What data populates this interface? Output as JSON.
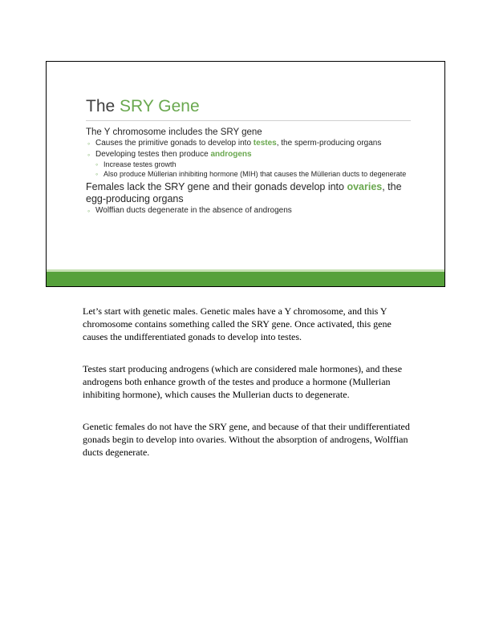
{
  "slide": {
    "title_prefix": "The ",
    "title_accent": "SRY Gene",
    "lines": [
      {
        "level": 1,
        "parts": [
          {
            "text": "The Y chromosome includes the SRY gene"
          }
        ]
      },
      {
        "level": 2,
        "parts": [
          {
            "text": "Causes the primitive gonads to develop into "
          },
          {
            "text": "testes",
            "hl": true
          },
          {
            "text": ", the sperm-producing organs"
          }
        ]
      },
      {
        "level": 2,
        "parts": [
          {
            "text": "Developing testes then produce "
          },
          {
            "text": "androgens",
            "hl": true
          }
        ]
      },
      {
        "level": 3,
        "parts": [
          {
            "text": "Increase testes growth"
          }
        ]
      },
      {
        "level": 3,
        "parts": [
          {
            "text": "Also produce Müllerian inhibiting hormone (MIH) that causes the Müllerian ducts to degenerate"
          }
        ]
      },
      {
        "level": 1,
        "big": true,
        "parts": [
          {
            "text": "Females lack the SRY gene and their gonads develop into "
          },
          {
            "text": "ovaries",
            "hl": true
          },
          {
            "text": ", the egg-producing organs"
          }
        ]
      },
      {
        "level": 2,
        "parts": [
          {
            "text": "Wolffian ducts degenerate in the absence of androgens"
          }
        ]
      }
    ]
  },
  "notes": [
    "Let’s start with genetic males. Genetic males have a Y chromosome, and this Y chromosome contains something called the SRY gene. Once activated, this gene causes the undifferentiated gonads to develop into testes.",
    "Testes start producing androgens (which are considered male hormones), and these androgens both enhance growth of the testes and produce a hormone (Mullerian inhibiting hormone), which causes the Mullerian ducts to degenerate.",
    "Genetic females do not have the SRY gene, and because of that their undifferentiated gonads begin to develop into ovaries. Without the absorption of androgens, Wolffian ducts degenerate."
  ],
  "colors": {
    "accent": "#6aa84f",
    "bar": "#56a13b"
  }
}
